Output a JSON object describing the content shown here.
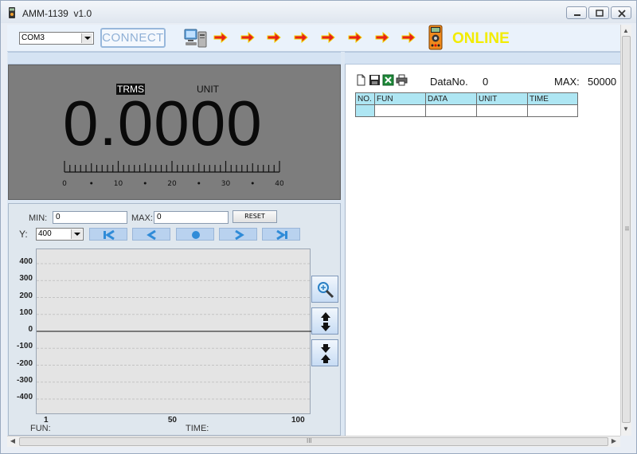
{
  "window": {
    "title": "AMM-1139",
    "version": "v1.0"
  },
  "toolbar": {
    "port": "COM3",
    "connect_label": "CONNECT",
    "status": "ONLINE",
    "status_color": "#f2ec00"
  },
  "meter": {
    "mode": "TRMS",
    "unit_label": "UNIT",
    "reading": "0.0000",
    "scale_labels": [
      "0",
      "10",
      "20",
      "30",
      "40"
    ]
  },
  "graph": {
    "min_label": "MIN:",
    "min_value": "0",
    "max_label": "MAX:",
    "max_value": "0",
    "reset_label": "RESET",
    "y_label": "Y:",
    "y_scale": "400",
    "y_ticks": [
      "400",
      "300",
      "200",
      "100",
      "0",
      "-100",
      "-200",
      "-300",
      "-400"
    ],
    "x_ticks": [
      "1",
      "50",
      "100"
    ],
    "fun_label": "FUN:",
    "time_label": "TIME:"
  },
  "log": {
    "datano_label": "DataNo.",
    "datano_value": "0",
    "max_label": "MAX:",
    "max_value": "50000",
    "columns": [
      "NO.",
      "FUN",
      "DATA",
      "UNIT",
      "TIME"
    ]
  },
  "scrollbar": {
    "grip": "III"
  }
}
